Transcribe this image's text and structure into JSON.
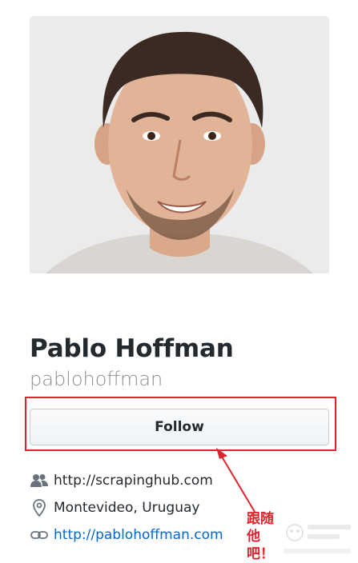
{
  "profile": {
    "fullname": "Pablo Hoffman",
    "username": "pablohoffman",
    "follow_label": "Follow"
  },
  "details": {
    "organization": "http://scrapinghub.com",
    "location": "Montevideo, Uruguay",
    "website": "http://pablohoffman.com"
  },
  "annotation": {
    "text": "跟随\n他吧！"
  },
  "colors": {
    "highlight": "#e0242b",
    "link": "#0366d6",
    "muted": "#8a8f94"
  },
  "icons": [
    "people-icon",
    "location-pin-icon",
    "link-icon"
  ]
}
